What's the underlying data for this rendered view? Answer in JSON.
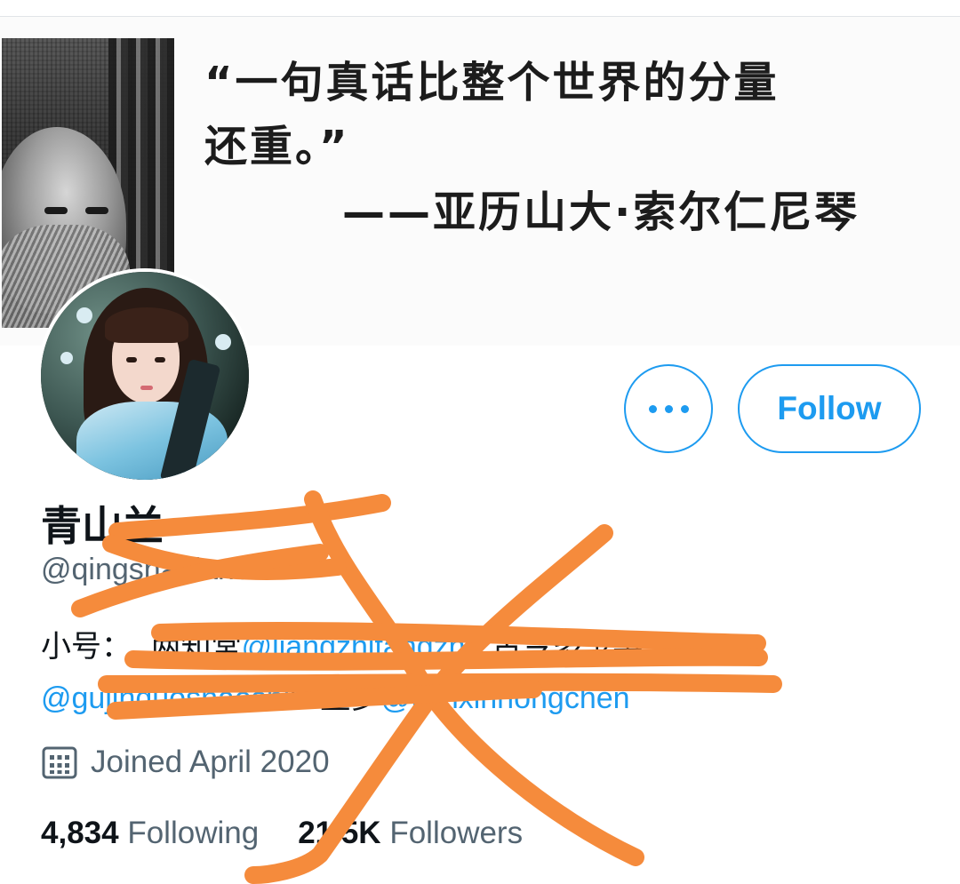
{
  "banner": {
    "quote_line1": "“一句真话比整个世界的分量",
    "quote_line2": "还重。”",
    "quote_attribution": "——亚历山大·索尔仁尼琴"
  },
  "actions": {
    "more_icon": "more-horizontal-icon",
    "follow_label": "Follow"
  },
  "profile": {
    "display_name": "青山兰",
    "handle": "@qingshanlan01",
    "bio_prefix": "小号：",
    "bio_text1": "两知堂",
    "bio_link1": "@liangzhitangzhu",
    "bio_text2": "古今多少事",
    "bio_link2": "@gujinduoshaoshi",
    "bio_text3": "红尘梦",
    "bio_link3": "@lianxinhongchen",
    "joined_icon": "calendar-icon",
    "joined": "Joined April 2020"
  },
  "stats": {
    "following_count": "4,834",
    "following_label": "Following",
    "followers_count": "21.5K",
    "followers_label": "Followers"
  },
  "colors": {
    "accent": "#1d9bf0",
    "secondary_text": "#536471",
    "overlay_scribble": "#f58b3c"
  }
}
